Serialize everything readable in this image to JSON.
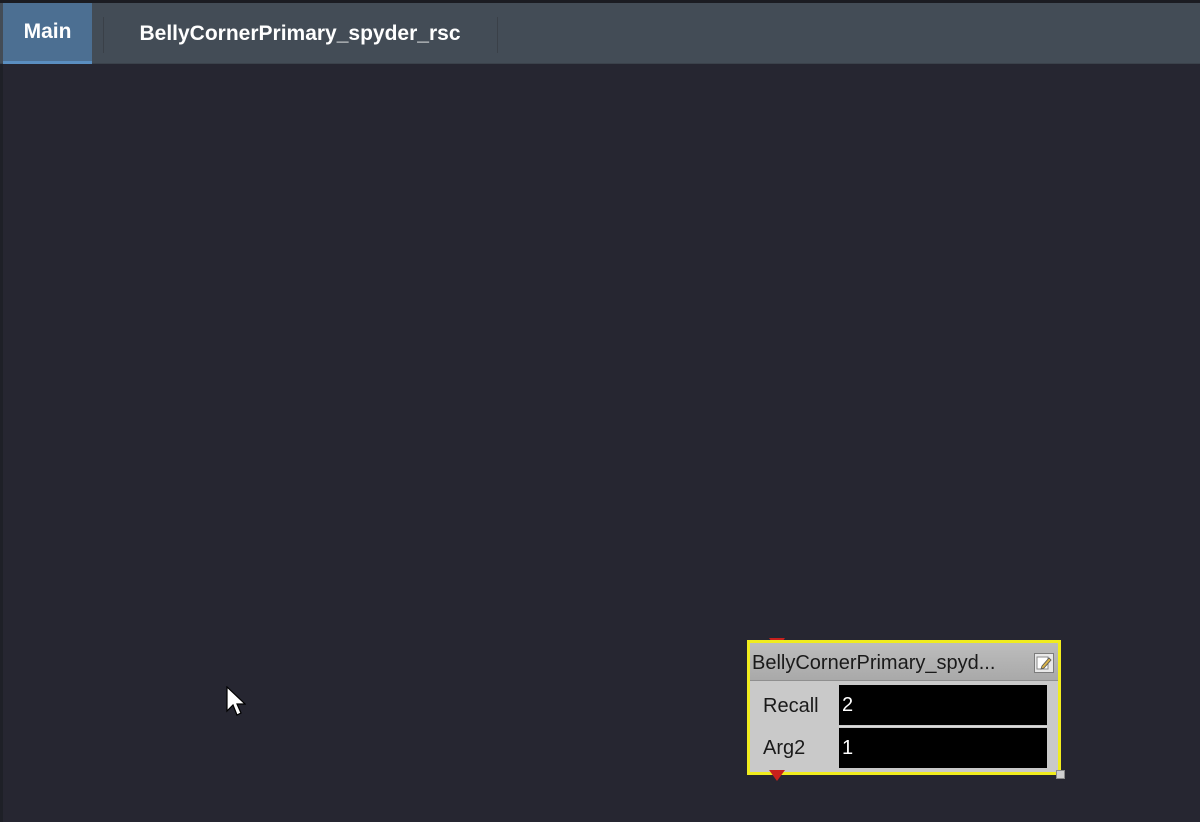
{
  "tabs": [
    {
      "label": "Main",
      "active": true
    },
    {
      "label": "BellyCornerPrimary_spyder_rsc",
      "active": false
    }
  ],
  "node": {
    "title": "BellyCornerPrimary_spyd...",
    "edit_icon": "pencil-edit-icon",
    "fields": [
      {
        "label": "Recall",
        "value": "2"
      },
      {
        "label": "Arg2",
        "value": "1"
      }
    ]
  },
  "colors": {
    "background": "#262631",
    "topbar": "#434c56",
    "active_tab": "#4c6f92",
    "node_border_selected": "#f0ec1e",
    "port": "#c8201c"
  }
}
